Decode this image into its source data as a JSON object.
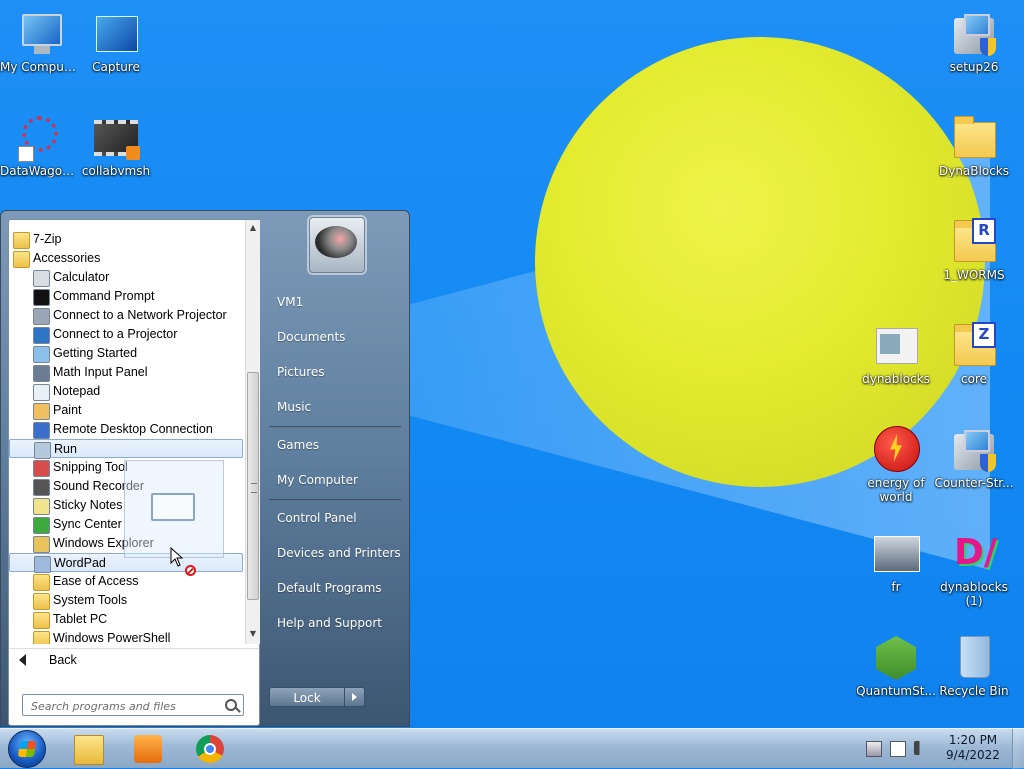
{
  "desktop": {
    "icons": [
      {
        "label": "My Computer",
        "icon": "computer-icon"
      },
      {
        "label": "Capture",
        "icon": "capture-icon"
      },
      {
        "label": "DataWagon...",
        "icon": "datawagon-icon"
      },
      {
        "label": "collabvmsh",
        "icon": "video-icon"
      },
      {
        "label": "setup26",
        "icon": "installer-icon"
      },
      {
        "label": "DynaBlocks",
        "icon": "folder-icon"
      },
      {
        "label": "1_WORMS",
        "icon": "folder-icon",
        "badge": "R"
      },
      {
        "label": "dynablocks",
        "icon": "webpage-icon"
      },
      {
        "label": "core",
        "icon": "folder-icon",
        "badge": "Z"
      },
      {
        "label": "energy of world",
        "icon": "energy-icon"
      },
      {
        "label": "Counter-Str...",
        "icon": "installer-icon"
      },
      {
        "label": "fr",
        "icon": "photo-icon"
      },
      {
        "label": "dynablocks (1)",
        "icon": "dynablocks-logo-icon"
      },
      {
        "label": "QuantumSt...",
        "icon": "nodejs-icon"
      },
      {
        "label": "Recycle Bin",
        "icon": "recycle-bin-icon"
      }
    ]
  },
  "startmenu": {
    "programs": [
      {
        "label": "7-Zip",
        "icon": "folder-icon",
        "indent": 0
      },
      {
        "label": "Accessories",
        "icon": "folder-icon",
        "indent": 0
      },
      {
        "label": "Calculator",
        "icon": "calculator-icon",
        "indent": 1
      },
      {
        "label": "Command Prompt",
        "icon": "cmd-icon",
        "indent": 1
      },
      {
        "label": "Connect to a Network Projector",
        "icon": "network-projector-icon",
        "indent": 1
      },
      {
        "label": "Connect to a Projector",
        "icon": "projector-icon",
        "indent": 1
      },
      {
        "label": "Getting Started",
        "icon": "getting-started-icon",
        "indent": 1
      },
      {
        "label": "Math Input Panel",
        "icon": "math-input-icon",
        "indent": 1
      },
      {
        "label": "Notepad",
        "icon": "notepad-icon",
        "indent": 1
      },
      {
        "label": "Paint",
        "icon": "paint-icon",
        "indent": 1
      },
      {
        "label": "Remote Desktop Connection",
        "icon": "remote-desktop-icon",
        "indent": 1
      },
      {
        "label": "Run",
        "icon": "run-icon",
        "indent": 1,
        "selected": true
      },
      {
        "label": "Snipping Tool",
        "icon": "snipping-tool-icon",
        "indent": 1
      },
      {
        "label": "Sound Recorder",
        "icon": "microphone-icon",
        "indent": 1
      },
      {
        "label": "Sticky Notes",
        "icon": "sticky-notes-icon",
        "indent": 1
      },
      {
        "label": "Sync Center",
        "icon": "sync-center-icon",
        "indent": 1
      },
      {
        "label": "Windows Explorer",
        "icon": "explorer-icon",
        "indent": 1
      },
      {
        "label": "WordPad",
        "icon": "wordpad-icon",
        "indent": 1,
        "selected": true
      },
      {
        "label": "Ease of Access",
        "icon": "folder-icon",
        "indent": 1
      },
      {
        "label": "System Tools",
        "icon": "folder-icon",
        "indent": 1
      },
      {
        "label": "Tablet PC",
        "icon": "folder-icon",
        "indent": 1
      },
      {
        "label": "Windows PowerShell",
        "icon": "folder-icon",
        "indent": 1
      }
    ],
    "back_label": "Back",
    "search_placeholder": "Search programs and files",
    "right_items": [
      {
        "label": "VM1"
      },
      {
        "label": "Documents"
      },
      {
        "label": "Pictures"
      },
      {
        "label": "Music"
      },
      {
        "label": "Games"
      },
      {
        "label": "My Computer"
      },
      {
        "label": "Control Panel"
      },
      {
        "label": "Devices and Printers"
      },
      {
        "label": "Default Programs"
      },
      {
        "label": "Help and Support"
      }
    ],
    "lock_label": "Lock"
  },
  "taskbar": {
    "pinned": [
      {
        "icon": "file-explorer-icon"
      },
      {
        "icon": "media-player-icon"
      },
      {
        "icon": "chrome-icon"
      }
    ],
    "clock_time": "1:20 PM",
    "clock_date": "9/4/2022"
  },
  "colors": {
    "desktop_bg": "#1289f1",
    "ball": "#e3eb2f",
    "start_menu_glass": "#5d7d9c",
    "selection": "#dbe9fa"
  }
}
